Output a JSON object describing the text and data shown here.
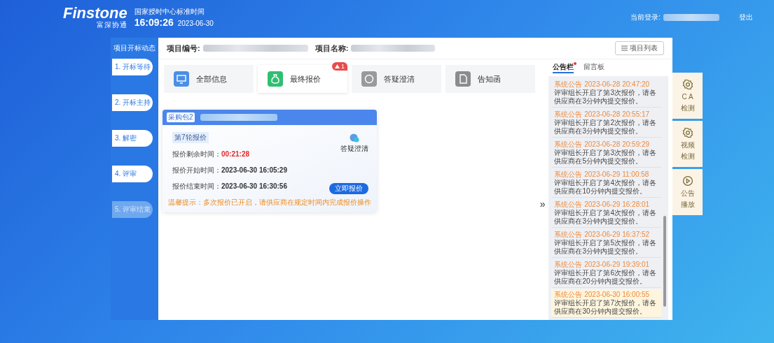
{
  "header": {
    "logo": "Finstone",
    "logo_subtitle": "富深协通",
    "clock_label": "国家授时中心标准时间",
    "time": "16:09:26",
    "date": "2023-06-30",
    "login_label": "当前登录:",
    "logout": "登出"
  },
  "steps": {
    "title": "项目开标动态",
    "items": [
      {
        "label": "1. 开标等待",
        "disabled": false
      },
      {
        "label": "2. 开标主持",
        "disabled": false
      },
      {
        "label": "3. 解密",
        "disabled": false
      },
      {
        "label": "4. 评审",
        "disabled": false
      },
      {
        "label": "5. 评审结束",
        "disabled": true
      }
    ]
  },
  "project": {
    "number_label": "项目编号:",
    "name_label": "项目名称:",
    "list_button": "项目列表"
  },
  "modules": [
    {
      "label": "全部信息",
      "kind": "monitor",
      "color": "#4a8fe8",
      "selected": false
    },
    {
      "label": "最终报价",
      "kind": "bag",
      "color": "#2fbf71",
      "selected": true,
      "badge": "1"
    },
    {
      "label": "答疑澄清",
      "kind": "chat",
      "color": "#9a9a9a",
      "selected": false
    },
    {
      "label": "告知函",
      "kind": "document",
      "color": "#8c8c8c",
      "selected": false
    }
  ],
  "quote_card": {
    "package_tag": "采购包2",
    "round": "第7轮报价",
    "remaining_label": "报价剩余时间：",
    "remaining": "00:21:28",
    "start_label": "报价开始时间：",
    "start": "2023-06-30 16:05:29",
    "end_label": "报价结束时间：",
    "end": "2023-06-30 16:30:56",
    "qa_link": "答疑澄清",
    "submit_button": "立即报价",
    "tip": "温馨提示：多次报价已开启，请供应商在规定时间内完成报价操作"
  },
  "expand_toggle": "»",
  "notice_tabs": [
    {
      "label": "公告栏",
      "selected": true,
      "unread": true
    },
    {
      "label": "留言板",
      "selected": false,
      "unread": false
    }
  ],
  "notices": [
    {
      "title": "系统公告",
      "time": "2023-06-28 20:47:20",
      "text": "评审组长开启了第3次报价，请各供应商在3分钟内提交报价。",
      "highlighted": false
    },
    {
      "title": "系统公告",
      "time": "2023-06-28 20:55:17",
      "text": "评审组长开启了第2次报价，请各供应商在3分钟内提交报价。",
      "highlighted": false
    },
    {
      "title": "系统公告",
      "time": "2023-06-28 20:59:29",
      "text": "评审组长开启了第3次报价，请各供应商在5分钟内提交报价。",
      "highlighted": false
    },
    {
      "title": "系统公告",
      "time": "2023-06-29 11:00:58",
      "text": "评审组长开启了第4次报价，请各供应商在10分钟内提交报价。",
      "highlighted": false
    },
    {
      "title": "系统公告",
      "time": "2023-06-29 16:28:01",
      "text": "评审组长开启了第4次报价，请各供应商在3分钟内提交报价。",
      "highlighted": false
    },
    {
      "title": "系统公告",
      "time": "2023-06-29 16:37:52",
      "text": "评审组长开启了第5次报价，请各供应商在3分钟内提交报价。",
      "highlighted": false
    },
    {
      "title": "系统公告",
      "time": "2023-06-29 19:39:01",
      "text": "评审组长开启了第6次报价，请各供应商在20分钟内提交报价。",
      "highlighted": false
    },
    {
      "title": "系统公告",
      "time": "2023-06-30 16:00:55",
      "text": "评审组长开启了第7次报价，请各供应商在30分钟内提交报价。",
      "highlighted": true
    }
  ],
  "side_tools": [
    {
      "kind": "gear",
      "lines": [
        "C A",
        "检测"
      ]
    },
    {
      "kind": "gear",
      "lines": [
        "视频",
        "检测"
      ]
    },
    {
      "kind": "play",
      "lines": [
        "公告",
        "播放"
      ]
    }
  ]
}
